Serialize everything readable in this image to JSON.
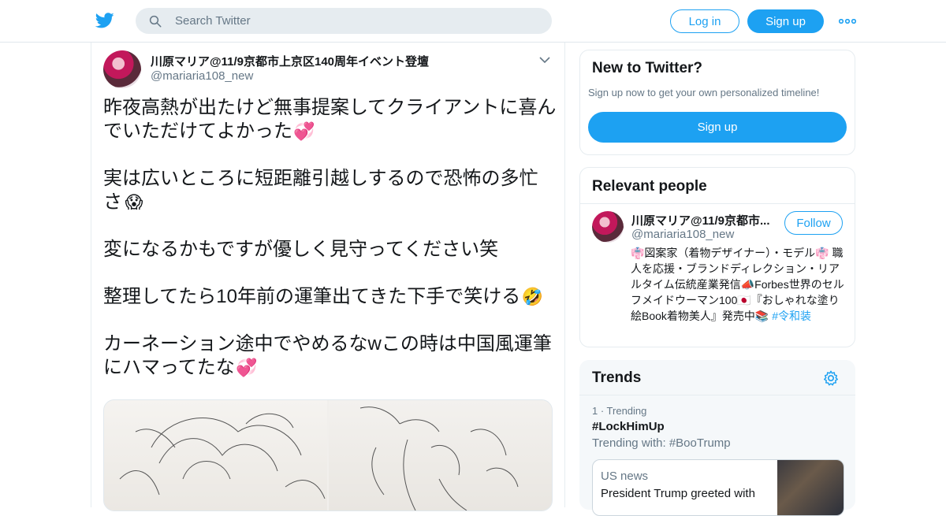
{
  "header": {
    "search_placeholder": "Search Twitter",
    "login_label": "Log in",
    "signup_label": "Sign up"
  },
  "tweet": {
    "user_name": "川原マリア@11/9京都市上京区140周年イベント登壇",
    "handle": "@mariaria108_new",
    "paragraphs": [
      {
        "text": "昨夜高熱が出たけど無事提案してクライアントに喜んでいただけてよかった",
        "emoji": "💞"
      },
      {
        "text": "実は広いところに短距離引越しするので恐怖の多忙さ",
        "emoji": "😱"
      },
      {
        "text": "変になるかもですが優しく見守ってください笑",
        "emoji": ""
      },
      {
        "text": "整理してたら10年前の運筆出てきた下手で笑ける",
        "emoji": "🤣"
      },
      {
        "text": "カーネーション途中でやめるなwこの時は中国風運筆にハマってたな",
        "emoji": "💞"
      }
    ]
  },
  "sidebar": {
    "new_to_twitter": {
      "title": "New to Twitter?",
      "subtitle": "Sign up now to get your own personalized timeline!",
      "signup_label": "Sign up"
    },
    "relevant_people": {
      "title": "Relevant people",
      "name": "川原マリア@11/9京都市...",
      "handle": "@mariaria108_new",
      "follow_label": "Follow",
      "bio": "👘図案家（着物デザイナー）・モデル👘 職人を応援・ブランドディレクション・リアルタイム伝統産業発信📣Forbes世界のセルフメイドウーマン100🇯🇵『おしゃれな塗り絵Book着物美人』発売中📚",
      "bio_hashtag": "#令和装"
    },
    "trends": {
      "title": "Trends",
      "meta": "1 · Trending",
      "name": "#LockHimUp",
      "with": "Trending with: #BooTrump",
      "card_category": "US news",
      "card_headline": "President Trump greeted with"
    }
  },
  "colors": {
    "accent": "#1da1f2",
    "muted": "#657786",
    "text": "#14171a"
  }
}
